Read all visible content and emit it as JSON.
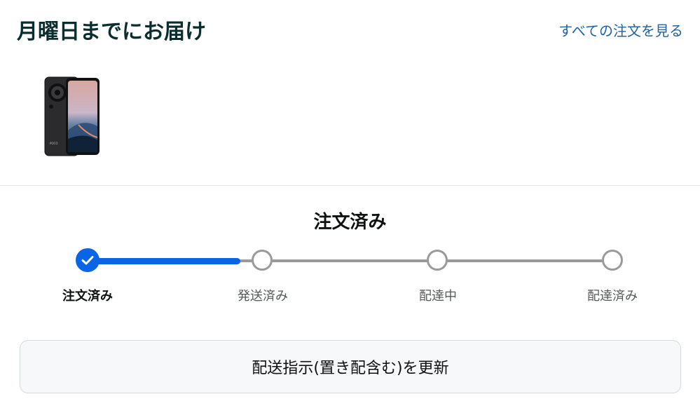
{
  "header": {
    "delivery_title": "月曜日までにお届け",
    "all_orders_link": "すべての注文を見る"
  },
  "product": {
    "image_icon": "smartphone-product-image",
    "brand_mark": "POCO"
  },
  "status": {
    "heading": "注文済み",
    "progress": 0.27,
    "steps": [
      {
        "label": "注文済み",
        "state": "done"
      },
      {
        "label": "発送済み",
        "state": "pending"
      },
      {
        "label": "配達中",
        "state": "pending"
      },
      {
        "label": "配達済み",
        "state": "pending"
      }
    ]
  },
  "actions": {
    "update_button": "配送指示(置き配含む)を更新"
  },
  "colors": {
    "accent": "#0a64e6",
    "link": "#2162a1",
    "title": "#0a2e2e",
    "inactive_track": "#9a9a9a"
  }
}
